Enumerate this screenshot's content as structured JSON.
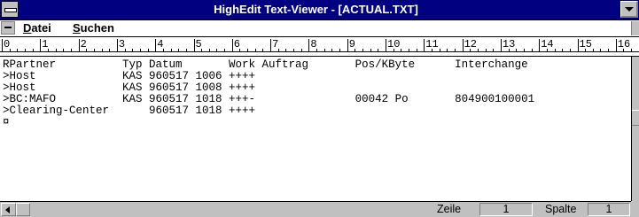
{
  "window": {
    "title": "HighEdit Text-Viewer - [ACTUAL.TXT]"
  },
  "menu": {
    "items": [
      {
        "underlined": "D",
        "rest": "atei"
      },
      {
        "underlined": "S",
        "rest": "uchen"
      }
    ]
  },
  "ruler": {
    "labels": [
      "0",
      "1",
      "2",
      "3",
      "4",
      "5",
      "6",
      "7",
      "8",
      "9",
      "10",
      "11",
      "12",
      "13",
      "14",
      "15",
      "16"
    ]
  },
  "document": {
    "lines": [
      "RPartner          Typ Datum       Work Auftrag       Pos/KByte      Interchange",
      ">Host             KAS 960517 1006 ++++",
      ">Host             KAS 960517 1008 ++++",
      ">BC:MAFO          KAS 960517 1018 +++-               00042 Po       804900100001",
      ">Clearing-Center      960517 1018 ++++",
      "¤"
    ]
  },
  "status": {
    "line_label": "Zeile",
    "line_value": "1",
    "column_label": "Spalte",
    "column_value": "1"
  },
  "colors": {
    "titlebar": "#000080",
    "chrome": "#c0c0c0"
  }
}
